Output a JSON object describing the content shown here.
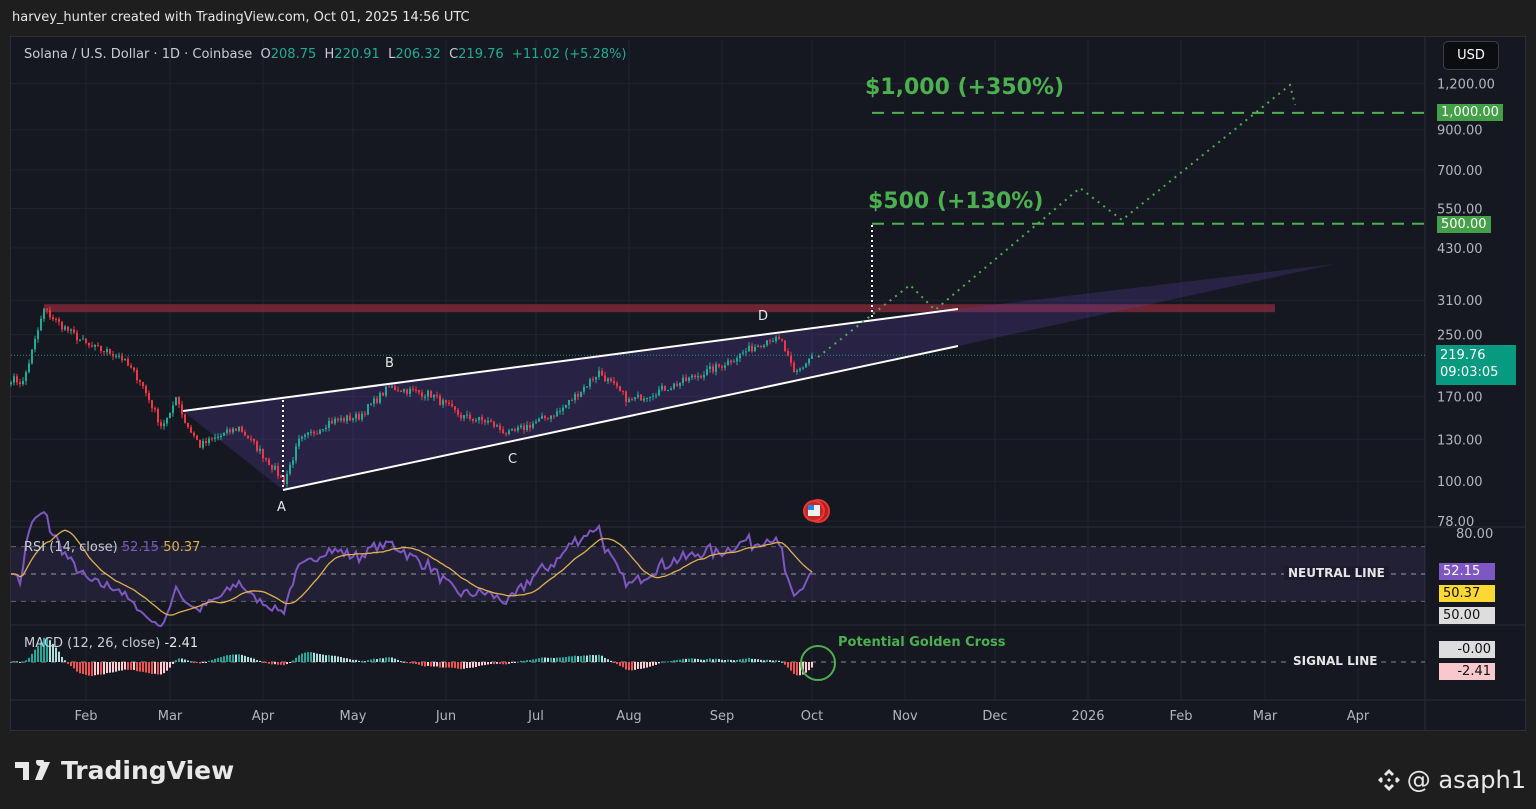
{
  "attribution": "harvey_hunter created with TradingView.com, Oct 01, 2025 14:56 UTC",
  "symbol": {
    "name": "Solana / U.S. Dollar · 1D · Coinbase",
    "o_label": "O",
    "open": "208.75",
    "h_label": "H",
    "high": "220.91",
    "l_label": "L",
    "low": "206.32",
    "c_label": "C",
    "close": "219.76",
    "change": "+11.02 (+5.28%)"
  },
  "currency_button": "USD",
  "price_axis": [
    "1,200.00",
    "900.00",
    "700.00",
    "550.00",
    "430.00",
    "310.00",
    "250.00",
    "170.00",
    "130.00",
    "100.00",
    "78.00"
  ],
  "price_axis_values": [
    1200,
    900,
    700,
    550,
    430,
    310,
    250,
    170,
    130,
    100,
    78
  ],
  "badges": {
    "target_high": "1,000.00",
    "target_low": "500.00",
    "last_price": "219.76",
    "countdown": "09:03:05",
    "rsi": "52.15",
    "rsi_ma": "50.37",
    "rsi_mid": "50.00",
    "rsi_top": "80.00",
    "macd_signal": "-0.00",
    "macd_hist": "-2.41"
  },
  "colors": {
    "up": "#22ab94",
    "down": "#f23645",
    "rsi": "#7e57c2",
    "rsi_ma": "#e0b050",
    "target": "#4caf50",
    "resistance": "#8b2a3a",
    "last": "#089981"
  },
  "annotations": {
    "target_high": "$1,000 (+350%)",
    "target_low": "$500 (+130%)",
    "point_a": "A",
    "point_b": "B",
    "point_c": "C",
    "point_d": "D",
    "neutral_line": "NEUTRAL LINE",
    "signal_line": "SIGNAL LINE",
    "golden_cross": "Potential Golden Cross"
  },
  "rsi_legend": {
    "label": "RSI (14, close)",
    "value": "52.15",
    "ma": "50.37"
  },
  "macd_legend": {
    "label": "MACD (12, 26, close)",
    "value": "-2.41"
  },
  "time_axis": [
    "Feb",
    "Mar",
    "Apr",
    "May",
    "Jun",
    "Jul",
    "Aug",
    "Sep",
    "Oct",
    "Nov",
    "Dec",
    "2026",
    "Feb",
    "Mar",
    "Apr"
  ],
  "footer": {
    "logo": "TradingView",
    "watermark": "@ asaph1"
  },
  "chart_data": {
    "type": "candlestick",
    "title": "Solana / U.S. Dollar · 1D · Coinbase",
    "ylabel": "USD",
    "yscale": "log",
    "ylim": [
      78,
      1250
    ],
    "xlim_days_since_2025_01_01": [
      2,
      470
    ],
    "price_path_keypoints": [
      [
        6,
        190
      ],
      [
        10,
        185
      ],
      [
        17,
        292
      ],
      [
        22,
        268
      ],
      [
        32,
        232
      ],
      [
        42,
        220
      ],
      [
        49,
        188
      ],
      [
        56,
        142
      ],
      [
        59,
        150
      ],
      [
        61,
        172
      ],
      [
        64,
        145
      ],
      [
        69,
        125
      ],
      [
        82,
        140
      ],
      [
        90,
        118
      ],
      [
        97,
        100
      ],
      [
        102,
        128
      ],
      [
        112,
        145
      ],
      [
        122,
        150
      ],
      [
        132,
        180
      ],
      [
        146,
        172
      ],
      [
        156,
        150
      ],
      [
        165,
        145
      ],
      [
        172,
        134
      ],
      [
        189,
        155
      ],
      [
        202,
        198
      ],
      [
        212,
        165
      ],
      [
        229,
        185
      ],
      [
        242,
        205
      ],
      [
        259,
        245
      ],
      [
        263,
        238
      ],
      [
        267,
        195
      ],
      [
        270,
        205
      ],
      [
        273,
        220
      ]
    ],
    "resistance": 295,
    "targets": [
      500,
      1000
    ],
    "rsi_levels": [
      30,
      50,
      70
    ]
  }
}
